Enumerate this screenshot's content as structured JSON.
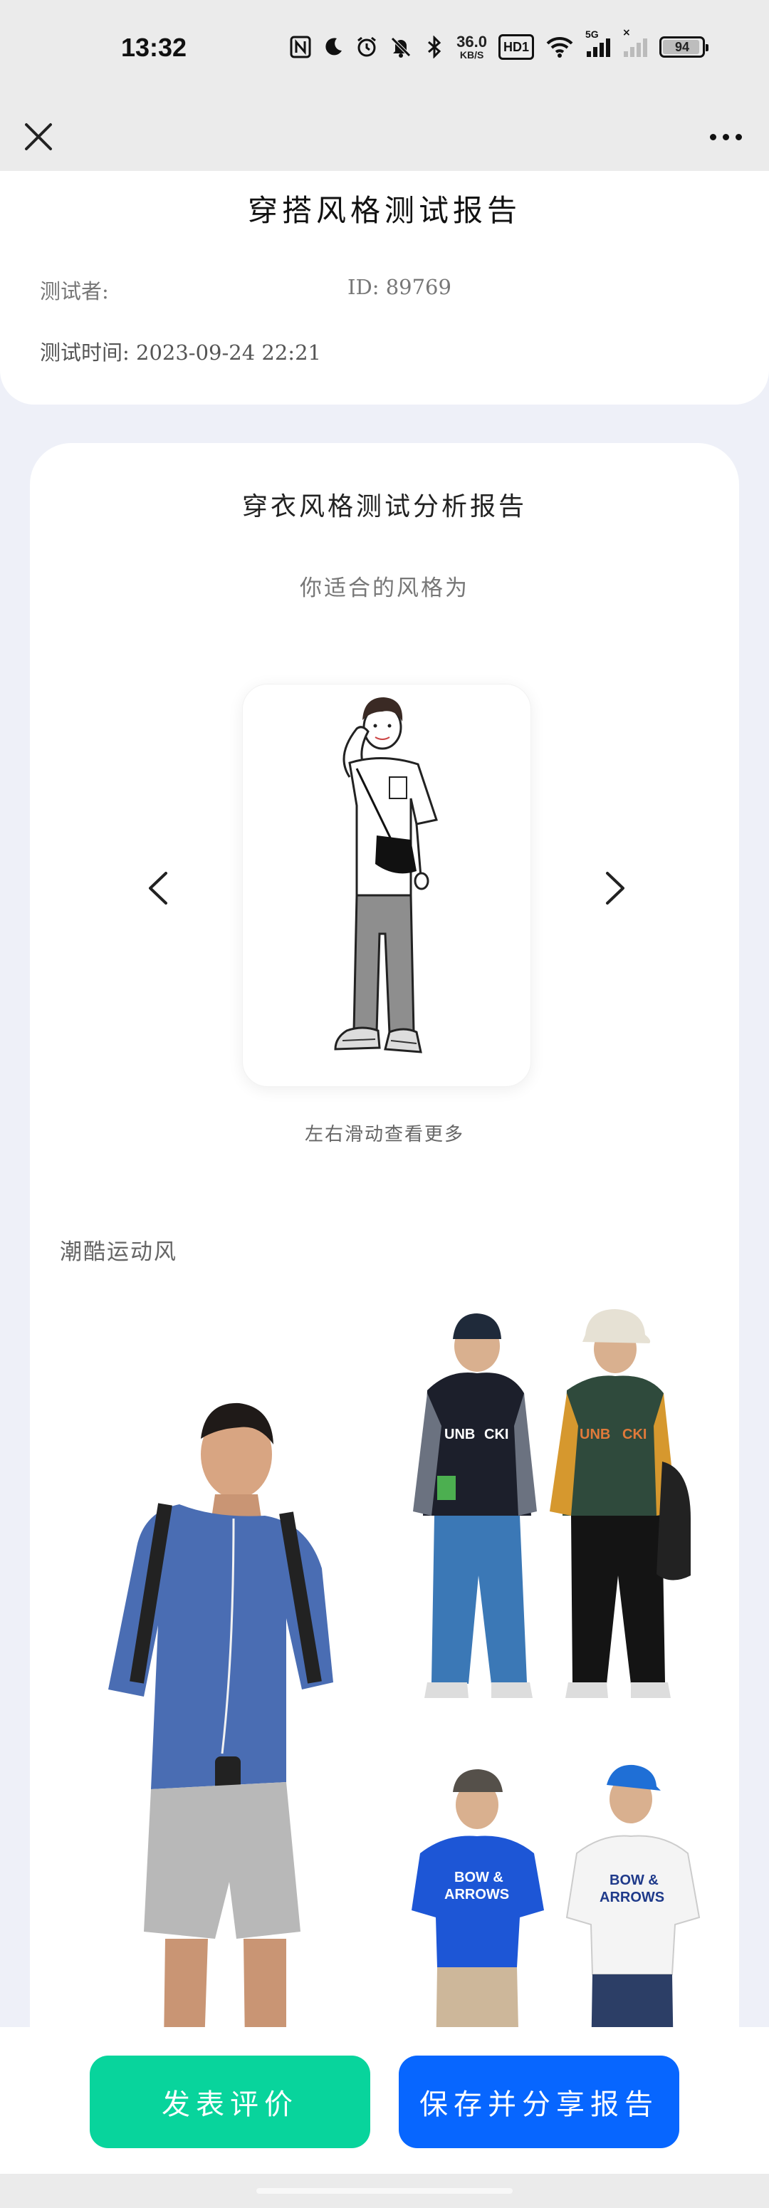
{
  "status_bar": {
    "time": "13:32",
    "net_speed_value": "36.0",
    "net_speed_unit": "KB/S",
    "hd_label": "HD1",
    "signal_label": "5G",
    "no_sim_mark": "×",
    "battery_level": "94",
    "icons": [
      "nfc-icon",
      "moon-icon",
      "alarm-icon",
      "mute-icon",
      "bluetooth-icon",
      "hd-icon",
      "wifi-icon",
      "signal-5g-icon",
      "signal-empty-icon",
      "battery-icon"
    ]
  },
  "nav": {
    "close_icon": "close-icon",
    "more_icon": "more-icon"
  },
  "report": {
    "title": "穿搭风格测试报告",
    "tester_label": "测试者:",
    "id_label": "ID: 89769",
    "time_label": "测试时间: 2023-09-24 22:21"
  },
  "analysis": {
    "title": "穿衣风格测试分析报告",
    "subtitle": "你适合的风格为",
    "swipe_hint": "左右滑动查看更多",
    "style_name": "潮酷运动风",
    "prev_icon": "chevron-left-icon",
    "next_icon": "chevron-right-icon"
  },
  "photos": {
    "b_prints": [
      "UNB",
      "CKI",
      "UNB",
      "CKI"
    ],
    "c_prints": [
      "BOW &",
      "ARROWS",
      "BOW &",
      "ARROWS"
    ]
  },
  "actions": {
    "review_label": "发表评价",
    "save_label": "保存并分享报告"
  },
  "colors": {
    "page_bg": "#eef0f8",
    "review_button": "#08d49c",
    "save_button": "#0766ff"
  }
}
